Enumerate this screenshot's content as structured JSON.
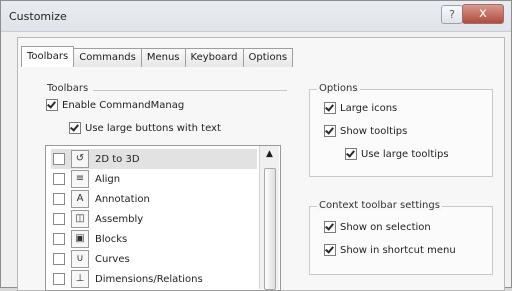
{
  "window": {
    "title": "Customize",
    "help_icon": "?",
    "close_icon": "x"
  },
  "tabs": [
    {
      "label": "Toolbars"
    },
    {
      "label": "Commands"
    },
    {
      "label": "Menus"
    },
    {
      "label": "Keyboard"
    },
    {
      "label": "Options"
    }
  ],
  "toolbars_section": {
    "group_label": "Toolbars",
    "enable_label": "Enable CommandManag",
    "large_buttons_label": "Use large buttons with text",
    "enable_checked": true,
    "large_buttons_checked": true
  },
  "toolbar_list": [
    {
      "label": "2D to 3D",
      "icon": "2d-to-3d-icon",
      "checked": false,
      "selected": true
    },
    {
      "label": "Align",
      "icon": "align-icon",
      "checked": false,
      "selected": false
    },
    {
      "label": "Annotation",
      "icon": "annotation-icon",
      "checked": false,
      "selected": false
    },
    {
      "label": "Assembly",
      "icon": "assembly-icon",
      "checked": false,
      "selected": false
    },
    {
      "label": "Blocks",
      "icon": "blocks-icon",
      "checked": false,
      "selected": false
    },
    {
      "label": "Curves",
      "icon": "curves-icon",
      "checked": false,
      "selected": false
    },
    {
      "label": "Dimensions/Relations",
      "icon": "dimensions-relations-icon",
      "checked": false,
      "selected": false
    }
  ],
  "options_section": {
    "group_label": "Options",
    "large_icons_label": "Large icons",
    "show_tooltips_label": "Show tooltips",
    "large_tooltips_label": "Use large tooltips",
    "large_icons_checked": true,
    "show_tooltips_checked": true,
    "large_tooltips_checked": true
  },
  "context_section": {
    "group_label": "Context toolbar settings",
    "show_on_selection_label": "Show on selection",
    "show_in_shortcut_label": "Show in shortcut menu",
    "show_on_selection_checked": true,
    "show_in_shortcut_checked": true
  }
}
